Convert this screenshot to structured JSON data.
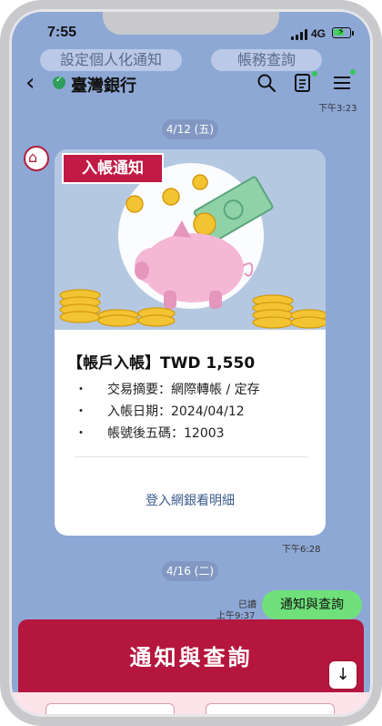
{
  "status_bar": {
    "time": "7:55",
    "network": "4G"
  },
  "ghost_buttons": {
    "left": "設定個人化通知",
    "right": "帳務查詢"
  },
  "header": {
    "back_icon": "chevron-left",
    "title": "臺灣銀行",
    "verified_icon": "shield-check",
    "icons": [
      "search-icon",
      "notes-icon",
      "menu-icon"
    ],
    "accent": "#34c759"
  },
  "chat": {
    "top_timestamp": "下午3:23",
    "date1": "4/12 (五)",
    "card": {
      "tag": "入帳通知",
      "title": "【帳戶入帳】TWD 1,550",
      "lines": [
        {
          "bullet": "・",
          "text": "交易摘要：網際轉帳 / 定存"
        },
        {
          "bullet": "・",
          "text": "入帳日期：2024/04/12"
        },
        {
          "bullet": "・",
          "text": "帳號後五碼：12003"
        }
      ],
      "link": "登入網銀看明細",
      "timestamp": "下午6:28",
      "tag_color": "#c01a45"
    },
    "date2": "4/16 (二)",
    "my_message": {
      "read": "已讀",
      "time": "上午9:37",
      "text": "通知與查詢",
      "color": "#6fe07a"
    }
  },
  "banner": {
    "label": "通知與查詢",
    "color": "#b5163e"
  },
  "scroll_down_icon": "arrow-down"
}
